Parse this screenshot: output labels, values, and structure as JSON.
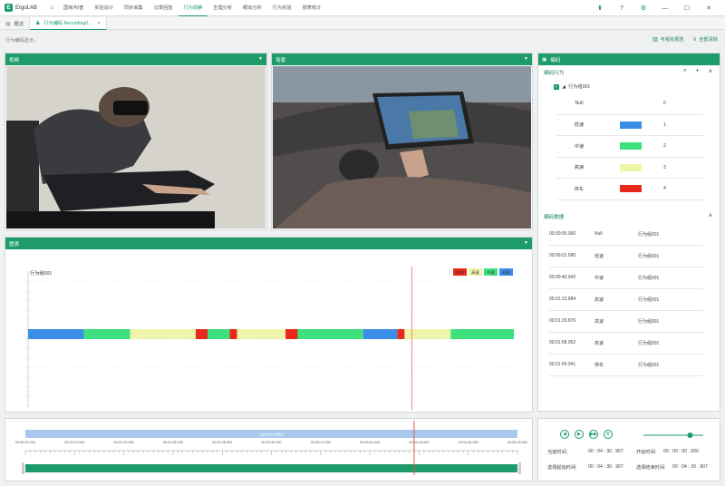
{
  "app": {
    "title": "ErgoLAB"
  },
  "menu": [
    {
      "label": "国家/科普",
      "active": false
    },
    {
      "label": "实验设计",
      "active": false
    },
    {
      "label": "同步采集",
      "active": false
    },
    {
      "label": "记录回放",
      "active": false
    },
    {
      "label": "行为观察",
      "active": true
    },
    {
      "label": "生理分析",
      "active": false
    },
    {
      "label": "眼动分析",
      "active": false
    },
    {
      "label": "行为实验",
      "active": false
    },
    {
      "label": "报表统计",
      "active": false
    }
  ],
  "tabs": [
    {
      "label": "概述",
      "active": false
    },
    {
      "label": "行为编码 Recording0...",
      "active": true,
      "close": "×"
    }
  ],
  "hint": "行为编码显示。",
  "sub_actions": {
    "report": "可视化报告",
    "export": "全部清除"
  },
  "panels": {
    "video": "视频",
    "scene": "场景",
    "chart": "图表",
    "coding": "编码"
  },
  "coding": {
    "section_title": "编码行为",
    "group_name": "行为组001",
    "behaviors": [
      {
        "name": "Null",
        "color": "",
        "key": "0"
      },
      {
        "name": "低速",
        "color": "#3a8ee6",
        "key": "1"
      },
      {
        "name": "中速",
        "color": "#3ee07e",
        "key": "2"
      },
      {
        "name": "高速",
        "color": "#eef5a8",
        "key": "3"
      },
      {
        "name": "停车",
        "color": "#e8291c",
        "key": "4"
      }
    ],
    "data_title": "编码数据",
    "data_rows": [
      {
        "time": "00:00:00.000",
        "behavior": "Null",
        "group": "行为组001"
      },
      {
        "time": "00:00:01.580",
        "behavior": "低速",
        "group": "行为组001"
      },
      {
        "time": "00:00:40.942",
        "behavior": "中速",
        "group": "行为组001"
      },
      {
        "time": "00:01:13.884",
        "behavior": "高速",
        "group": "行为组001"
      },
      {
        "time": "00:01:29.876",
        "behavior": "高速",
        "group": "行为组001"
      },
      {
        "time": "00:01:58.952",
        "behavior": "高速",
        "group": "行为组001"
      },
      {
        "time": "00:01:59.941",
        "behavior": "停车",
        "group": "行为组001"
      }
    ]
  },
  "chart_data": {
    "type": "bar",
    "orientation": "horizontal-timeline",
    "series_label": "行为组001",
    "legend": [
      {
        "name": "停车",
        "color": "#e8291c"
      },
      {
        "name": "高速",
        "color": "#eef5a8"
      },
      {
        "name": "中速",
        "color": "#3ee07e"
      },
      {
        "name": "低速",
        "color": "#3a8ee6"
      }
    ],
    "segments_fraction": [
      {
        "start": 0.0,
        "end": 0.115,
        "behavior": "低速"
      },
      {
        "start": 0.115,
        "end": 0.21,
        "behavior": "中速"
      },
      {
        "start": 0.21,
        "end": 0.345,
        "behavior": "高速"
      },
      {
        "start": 0.345,
        "end": 0.37,
        "behavior": "停车"
      },
      {
        "start": 0.37,
        "end": 0.415,
        "behavior": "中速"
      },
      {
        "start": 0.415,
        "end": 0.43,
        "behavior": "停车"
      },
      {
        "start": 0.43,
        "end": 0.53,
        "behavior": "高速"
      },
      {
        "start": 0.53,
        "end": 0.555,
        "behavior": "停车"
      },
      {
        "start": 0.555,
        "end": 0.69,
        "behavior": "中速"
      },
      {
        "start": 0.69,
        "end": 0.76,
        "behavior": "低速"
      },
      {
        "start": 0.76,
        "end": 0.775,
        "behavior": "停车"
      },
      {
        "start": 0.775,
        "end": 0.87,
        "behavior": "高速"
      },
      {
        "start": 0.87,
        "end": 1.0,
        "behavior": "中速"
      }
    ],
    "cursor_fraction": 0.79
  },
  "timeline": {
    "track_label": "Camera Video",
    "ticks": [
      "00:00:00.000",
      "00:00:12.000",
      "00:01:04.000",
      "00:01:36.000",
      "00:02:08.000",
      "00:02:40.000",
      "00:03:12.000",
      "00:03:44.000",
      "00:04:16.000",
      "00:04:40.000",
      "00:05:20.000"
    ],
    "cursor_fraction": 0.79
  },
  "playback": {
    "current_label": "当前时间:",
    "current_value": "00 : 04 : 30 . 907",
    "start_label": "开始时间:",
    "start_value": "00 : 00 : 00 . 000",
    "sel_start_label": "选择起始时间:",
    "sel_start_value": "00 : 04 : 30 . 907",
    "sel_end_label": "选择结束时间:",
    "sel_end_value": "00 : 04 : 30 . 907",
    "volume": 0.78
  }
}
